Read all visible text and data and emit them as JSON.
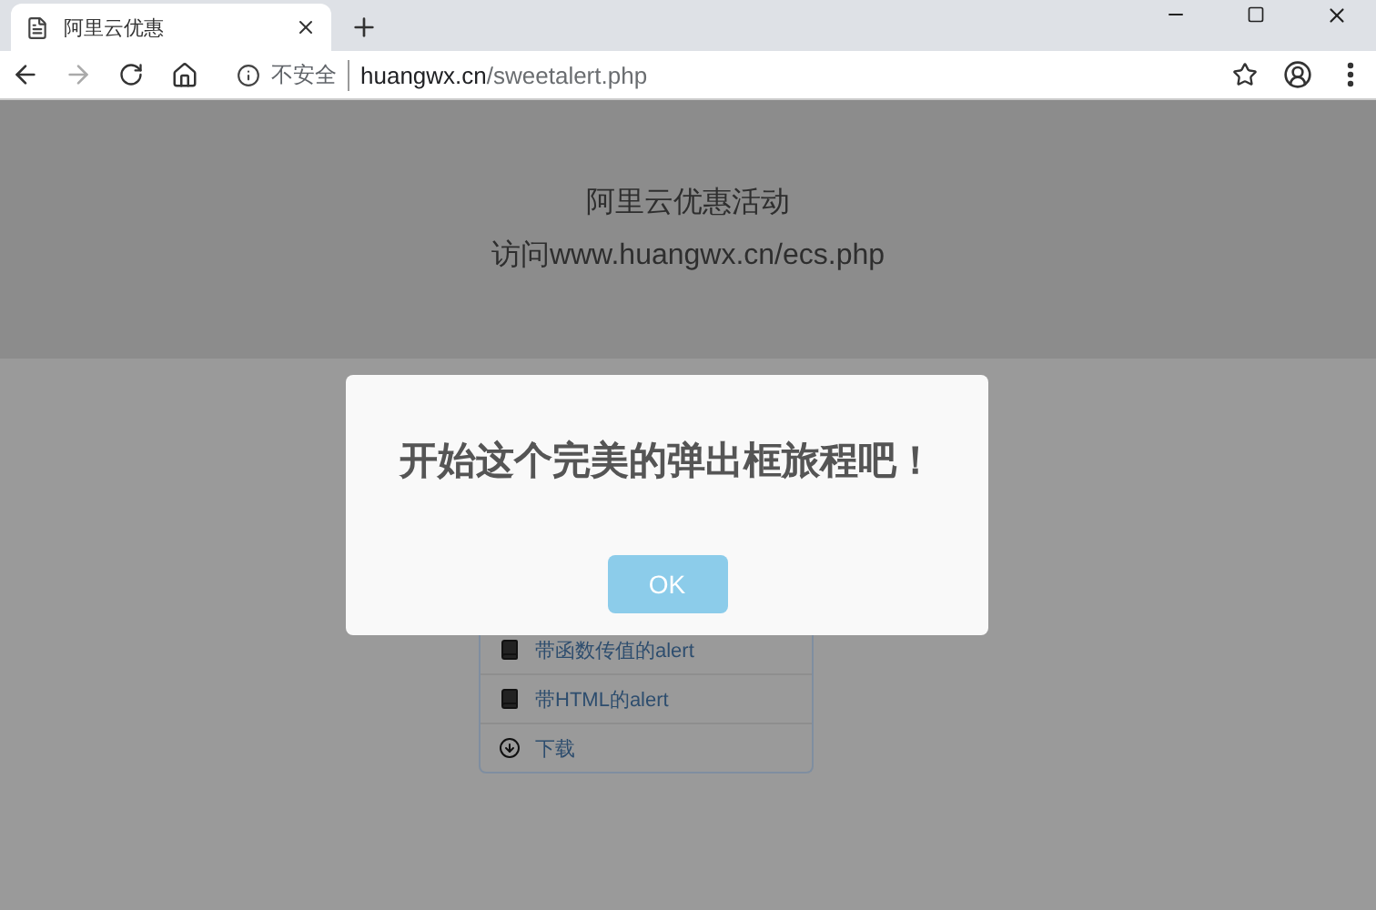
{
  "tabs": [
    {
      "title": "阿里云优惠",
      "selected": true
    }
  ],
  "address": {
    "security": "不安全",
    "host": "huangwx.cn",
    "path": "/sweetalert.php"
  },
  "header": {
    "lines": [
      "阿里云优惠活动",
      "访问www.huangwx.cn/ecs.php"
    ]
  },
  "list": [
    {
      "kind": "book",
      "label": "带函数传值的alert"
    },
    {
      "kind": "book",
      "label": "带HTML的alert"
    },
    {
      "kind": "download",
      "label": "下载"
    }
  ],
  "dialog": {
    "title": "开始这个完美的弹出框旅程吧！",
    "button": "OK"
  }
}
